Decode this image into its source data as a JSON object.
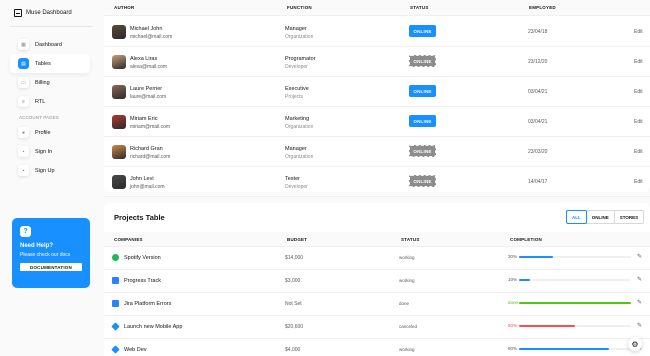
{
  "brand": {
    "title": "Muse Dashboard"
  },
  "sidebar": {
    "items": [
      {
        "label": "Dashboard",
        "icon": "dashboard-icon",
        "glyph": "▦"
      },
      {
        "label": "Tables",
        "icon": "tables-icon",
        "glyph": "▤"
      },
      {
        "label": "Billing",
        "icon": "billing-icon",
        "glyph": "▭"
      },
      {
        "label": "RTL",
        "icon": "rtl-icon",
        "glyph": "≡"
      }
    ],
    "section_label": "ACCOUNT PAGES",
    "account_items": [
      {
        "label": "Profile",
        "icon": "profile-icon",
        "glyph": "●"
      },
      {
        "label": "Sign In",
        "icon": "sign-in-icon",
        "glyph": "▪"
      },
      {
        "label": "Sign Up",
        "icon": "sign-up-icon",
        "glyph": "▪"
      }
    ]
  },
  "help": {
    "title": "Need Help?",
    "subtitle": "Please check our docs",
    "button": "DOCUMENTATION",
    "icon": "question-icon"
  },
  "authors": {
    "headers": {
      "author": "AUTHOR",
      "function": "FUNCTION",
      "status": "STATUS",
      "employed": "EMPLOYED"
    },
    "rows": [
      {
        "name": "Michael John",
        "email": "michael@mail.com",
        "role": "Manager",
        "org": "Organization",
        "status": "ONLINE",
        "online": true,
        "date": "23/04/18",
        "edit": "Edit",
        "avatar_color": "#5a4a3a"
      },
      {
        "name": "Alexa Liras",
        "email": "alexa@mail.com",
        "role": "Programator",
        "org": "Developer",
        "status": "ONLINE",
        "online": false,
        "date": "23/12/20",
        "edit": "Edit",
        "avatar_color": "#c9a07a"
      },
      {
        "name": "Laure Perrier",
        "email": "laure@mail.com",
        "role": "Executive",
        "org": "Projects",
        "status": "ONLINE",
        "online": true,
        "date": "03/04/21",
        "edit": "Edit",
        "avatar_color": "#8a6a52"
      },
      {
        "name": "Miriam Eric",
        "email": "miriam@mail.com",
        "role": "Marketing",
        "org": "Organization",
        "status": "ONLINE",
        "online": true,
        "date": "03/04/21",
        "edit": "Edit",
        "avatar_color": "#b03a2e"
      },
      {
        "name": "Richard Gran",
        "email": "richard@mail.com",
        "role": "Manager",
        "org": "Organization",
        "status": "ONLINE",
        "online": false,
        "date": "23/03/20",
        "edit": "Edit",
        "avatar_color": "#d08a4a"
      },
      {
        "name": "John Levi",
        "email": "john@mail.com",
        "role": "Tester",
        "org": "Developer",
        "status": "ONLINE",
        "online": false,
        "date": "14/04/17",
        "edit": "Edit",
        "avatar_color": "#4a4a4a"
      }
    ]
  },
  "projects": {
    "title": "Projects Table",
    "filters": [
      "ALL",
      "ONLINE",
      "STORES"
    ],
    "headers": {
      "companies": "COMPANIES",
      "budget": "BUDGET",
      "status": "STATUS",
      "completion": "COMPLETION"
    },
    "rows": [
      {
        "name": "Spotify Version",
        "budget": "$14,000",
        "status": "working",
        "pct_label": "30%",
        "pct": 30,
        "color": "#1890ff",
        "logo": "spotify-logo-icon",
        "logo_color": "#1db954"
      },
      {
        "name": "Progress Track",
        "budget": "$3,000",
        "status": "working",
        "pct_label": "10%",
        "pct": 10,
        "color": "#1890ff",
        "logo": "progress-track-logo-icon",
        "logo_color": "#2684ff"
      },
      {
        "name": "Jira Platform Errors",
        "budget": "Not Set",
        "status": "done",
        "pct_label": "done",
        "pct": 100,
        "color": "#52c41a",
        "logo": "jira-logo-icon",
        "logo_color": "#2684ff"
      },
      {
        "name": "Launch new Mobile App",
        "budget": "$20,600",
        "status": "canceled",
        "pct_label": "50%",
        "pct": 50,
        "color": "#ff4d4f",
        "logo": "mobile-app-logo-icon",
        "logo_color": "#1890ff"
      },
      {
        "name": "Web Dev",
        "budget": "$4,000",
        "status": "working",
        "pct_label": "80%",
        "pct": 80,
        "color": "#1890ff",
        "logo": "web-dev-logo-icon",
        "logo_color": "#1890ff"
      }
    ]
  },
  "icons": {
    "edit": "pencil-icon",
    "settings": "gear-icon"
  }
}
